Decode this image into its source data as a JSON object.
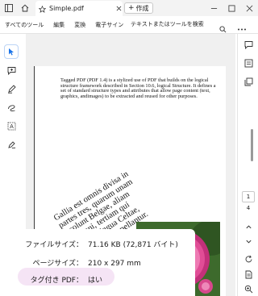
{
  "titlebar": {
    "tab_title": "Simple.pdf",
    "new_tab_label": "作成",
    "colors": {
      "background": "#f3f3f3",
      "accent": "#1a73e8"
    }
  },
  "menubar": {
    "items": [
      "すべてのツール",
      "編集",
      "変換",
      "電子サイン"
    ],
    "search_label": "テキストまたはツールを検索"
  },
  "document": {
    "paragraph": "Tagged PDF (PDF 1.4) is a stylized use of PDF that builds on the logical structure framework described in Section 10.6, logical Structure. It defines a set of standard structure types and attributes that allow page content (text, graphics, andimages) to be extracted and reused for other purposes.",
    "latin_text": "Gallia est omnis divisa in\npartes tres, quarum unam\nincolunt Belgae, aliam\nAquitani, tertiam qui\nipsorum lingua Celtae,\nnostra Galli appellantur."
  },
  "pager": {
    "current_page": "1",
    "total_pages": "4"
  },
  "properties": {
    "file_size_label": "ファイルサイズ：",
    "file_size_value": "71.16 KB (72,871 バイト)",
    "page_size_label": "ページサイズ：",
    "page_size_value": "210 x 297 mm",
    "tagged_label": "タグ付き PDF：",
    "tagged_value": "はい"
  }
}
